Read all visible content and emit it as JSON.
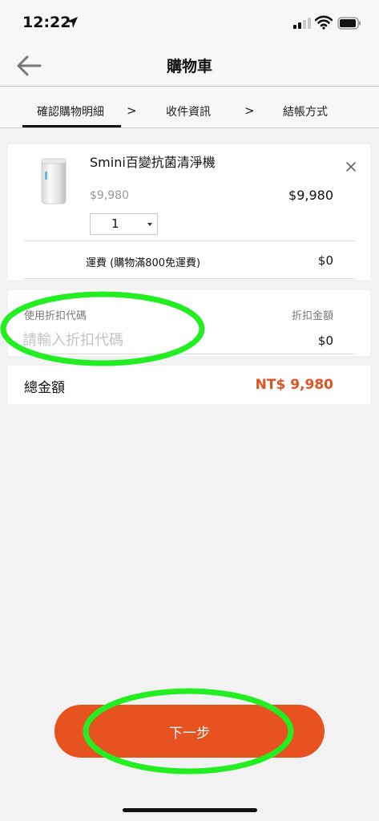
{
  "status_bar": {
    "time": "12:22"
  },
  "header": {
    "title": "購物車"
  },
  "steps": [
    {
      "label": "確認購物明細",
      "active": true
    },
    {
      "label": "收件資訊",
      "active": false
    },
    {
      "label": "結帳方式",
      "active": false
    }
  ],
  "step_separator": ">",
  "product": {
    "name": "Smini百變抗菌清淨機",
    "original_price": "$9,980",
    "price": "$9,980",
    "quantity": "1"
  },
  "shipping": {
    "label": "運費 (購物滿800免運費)",
    "value": "$0"
  },
  "coupon": {
    "label": "使用折扣代碼",
    "placeholder": "請輸入折扣代碼",
    "value": "",
    "discount_label": "折扣金額",
    "discount_value": "$0"
  },
  "total": {
    "label": "總金額",
    "value": "NT$ 9,980"
  },
  "next_button": {
    "label": "下一步"
  },
  "colors": {
    "accent": "#e65220",
    "total_text": "#e0521f",
    "annotation": "#22ee22"
  }
}
